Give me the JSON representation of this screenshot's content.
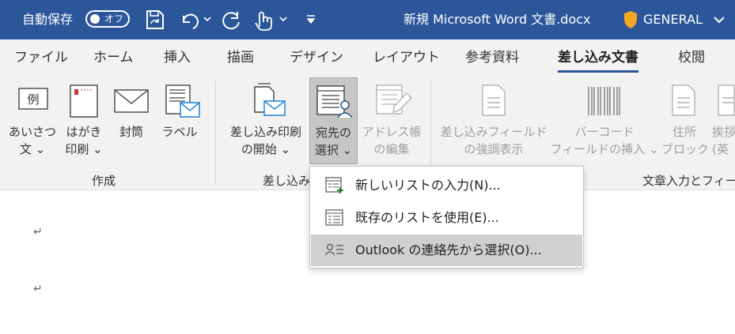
{
  "titlebar": {
    "autosave_label": "自動保存",
    "autosave_state": "オフ",
    "doc_title": "新規 Microsoft Word 文書.docx",
    "sensitivity": "GENERAL"
  },
  "tabs": [
    {
      "label": "ファイル"
    },
    {
      "label": "ホーム"
    },
    {
      "label": "挿入"
    },
    {
      "label": "描画"
    },
    {
      "label": "デザイン"
    },
    {
      "label": "レイアウト"
    },
    {
      "label": "参考資料"
    },
    {
      "label": "差し込み文書",
      "active": true
    },
    {
      "label": "校閲"
    }
  ],
  "ribbon": {
    "groups": {
      "create": "作成",
      "start": "差し込み",
      "insert": "文章入力とフィー"
    },
    "buttons": {
      "greetings": {
        "l1": "あいさつ",
        "l2": "文 ⌄"
      },
      "postcard": {
        "l1": "はがき",
        "l2": "印刷 ⌄",
        "icon_char": "例"
      },
      "envelope": {
        "l1": "封筒"
      },
      "labels": {
        "l1": "ラベル"
      },
      "start_merge": {
        "l1": "差し込み印刷",
        "l2": "の開始 ⌄"
      },
      "select_recipients": {
        "l1": "宛先の",
        "l2": "選択 ⌄"
      },
      "address_book": {
        "l1": "アドレス帳",
        "l2": "の編集"
      },
      "highlight_fields": {
        "l1": "差し込みフィールド",
        "l2": "の強調表示"
      },
      "barcode": {
        "l1": "バーコード",
        "l2": "フィールドの挿入 ⌄"
      },
      "address_block": {
        "l1": "住所",
        "l2": "ブロック"
      },
      "greeting_line": {
        "l1": "挨拶",
        "l2": "(英"
      }
    }
  },
  "menu": {
    "items": [
      {
        "label": "新しいリストの入力(N)..."
      },
      {
        "label": "既存のリストを使用(E)..."
      },
      {
        "label": "Outlook の連絡先から選択(O)..."
      }
    ]
  },
  "document": {
    "para_mark": "↵"
  },
  "colors": {
    "titlebar": "#2b579a",
    "ribbon": "#f3f2f1",
    "accent": "#2b579a",
    "shield": "#f5a623"
  }
}
